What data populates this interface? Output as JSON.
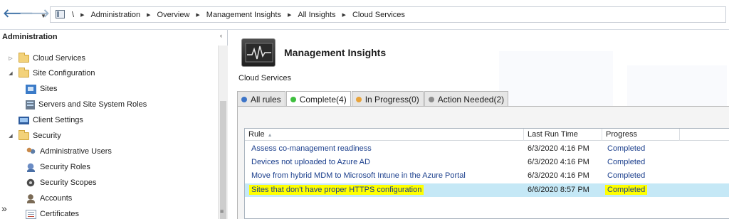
{
  "nav": {
    "breadcrumb_root": "\\",
    "breadcrumbs": [
      "Administration",
      "Overview",
      "Management Insights",
      "All Insights",
      "Cloud Services"
    ]
  },
  "left": {
    "title": "Administration",
    "collapse_glyph": "‹",
    "more_glyph": "»",
    "tree": [
      {
        "label": "Cloud Services",
        "icon": "folder-icon",
        "expander": "collapsed"
      },
      {
        "label": "Site Configuration",
        "icon": "folder-icon",
        "expander": "expanded"
      },
      {
        "label": "Sites",
        "icon": "sites-icon"
      },
      {
        "label": "Servers and Site System Roles",
        "icon": "server-icon"
      },
      {
        "label": "Client Settings",
        "icon": "client-settings-icon"
      },
      {
        "label": "Security",
        "icon": "folder-icon",
        "expander": "expanded"
      },
      {
        "label": "Administrative Users",
        "icon": "users-icon"
      },
      {
        "label": "Security Roles",
        "icon": "security-roles-icon"
      },
      {
        "label": "Security Scopes",
        "icon": "security-scopes-icon"
      },
      {
        "label": "Accounts",
        "icon": "accounts-icon"
      },
      {
        "label": "Certificates",
        "icon": "certificate-icon"
      }
    ]
  },
  "header": {
    "title": "Management Insights",
    "subtitle": "Cloud Services",
    "logo_icon": "monitor-graph-icon"
  },
  "tabs": [
    {
      "label": "All rules",
      "color": "#3c74c8",
      "active": false
    },
    {
      "label": "Complete(4)",
      "color": "#3fbf3f",
      "active": true
    },
    {
      "label": "In Progress(0)",
      "color": "#e8a33b",
      "active": false
    },
    {
      "label": "Action Needed(2)",
      "color": "#8c8c8c",
      "active": false
    }
  ],
  "grid": {
    "columns": [
      "Rule",
      "Last Run Time",
      "Progress"
    ],
    "sort_indicator": "▲",
    "rows": [
      {
        "rule": "Assess co-management readiness",
        "last_run": "6/3/2020 4:16 PM",
        "progress": "Completed",
        "selected": false
      },
      {
        "rule": "Devices not uploaded to Azure AD",
        "last_run": "6/3/2020 4:16 PM",
        "progress": "Completed",
        "selected": false
      },
      {
        "rule": "Move from hybrid MDM to Microsoft Intune in the Azure Portal",
        "last_run": "6/3/2020 4:16 PM",
        "progress": "Completed",
        "selected": false
      },
      {
        "rule": "Sites that don't have proper HTTPS configuration",
        "last_run": "6/6/2020 8:57 PM",
        "progress": "Completed",
        "selected": true,
        "highlighted": true
      }
    ],
    "selection_color": "#c5e8f6",
    "highlight_color": "#ffff00"
  }
}
